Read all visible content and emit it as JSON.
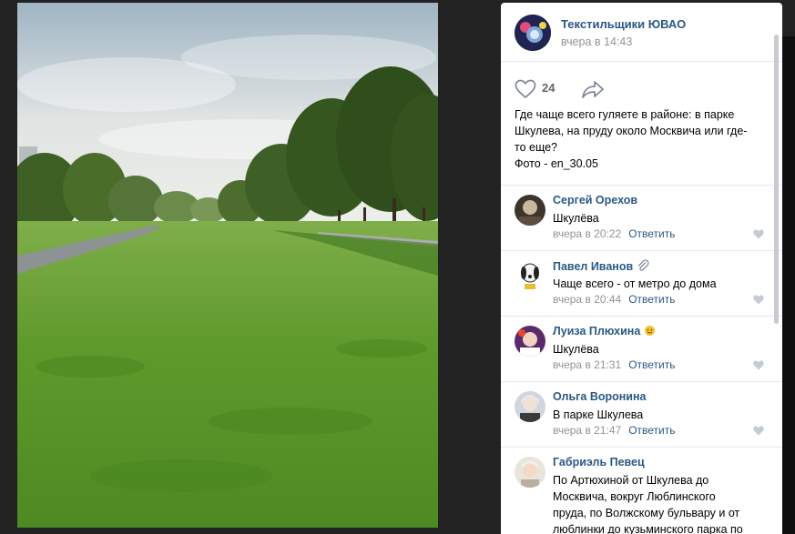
{
  "post": {
    "group_name": "Текстильщики ЮВАО",
    "time": "вчера в 14:43",
    "likes": "24",
    "text_lines": [
      "Где чаще всего гуляете в районе: в парке",
      "Шкулева, на пруду около Москвича или где-",
      "то еще?",
      "Фото - en_30.05"
    ]
  },
  "reply_label": "Ответить",
  "comments": [
    {
      "name": "Сергей Орехов",
      "text": "Шкулёва",
      "time": "вчера в 20:22",
      "badge": ""
    },
    {
      "name": "Павел Иванов",
      "text": "Чаще всего - от метро до дома",
      "time": "вчера в 20:44",
      "badge": "paperclip-icon"
    },
    {
      "name": "Луиза Плюхина",
      "text": "Шкулёва",
      "time": "вчера в 21:31",
      "badge": "emoji-icon"
    },
    {
      "name": "Ольга Воронина",
      "text": "В парке Шкулева",
      "time": "вчера в 21:47",
      "badge": ""
    },
    {
      "name": "Габриэль Певец",
      "text_lines": [
        "По Артюхиной от Шкулева до",
        "Москвича, вокруг Люблинского",
        "пруда, по Волжскому бульвару и от",
        "люблинки до кузьминского парка по"
      ],
      "time": "",
      "badge": ""
    }
  ],
  "colors": {
    "link": "#2a5885",
    "meta": "#939393",
    "background": "#222222"
  }
}
